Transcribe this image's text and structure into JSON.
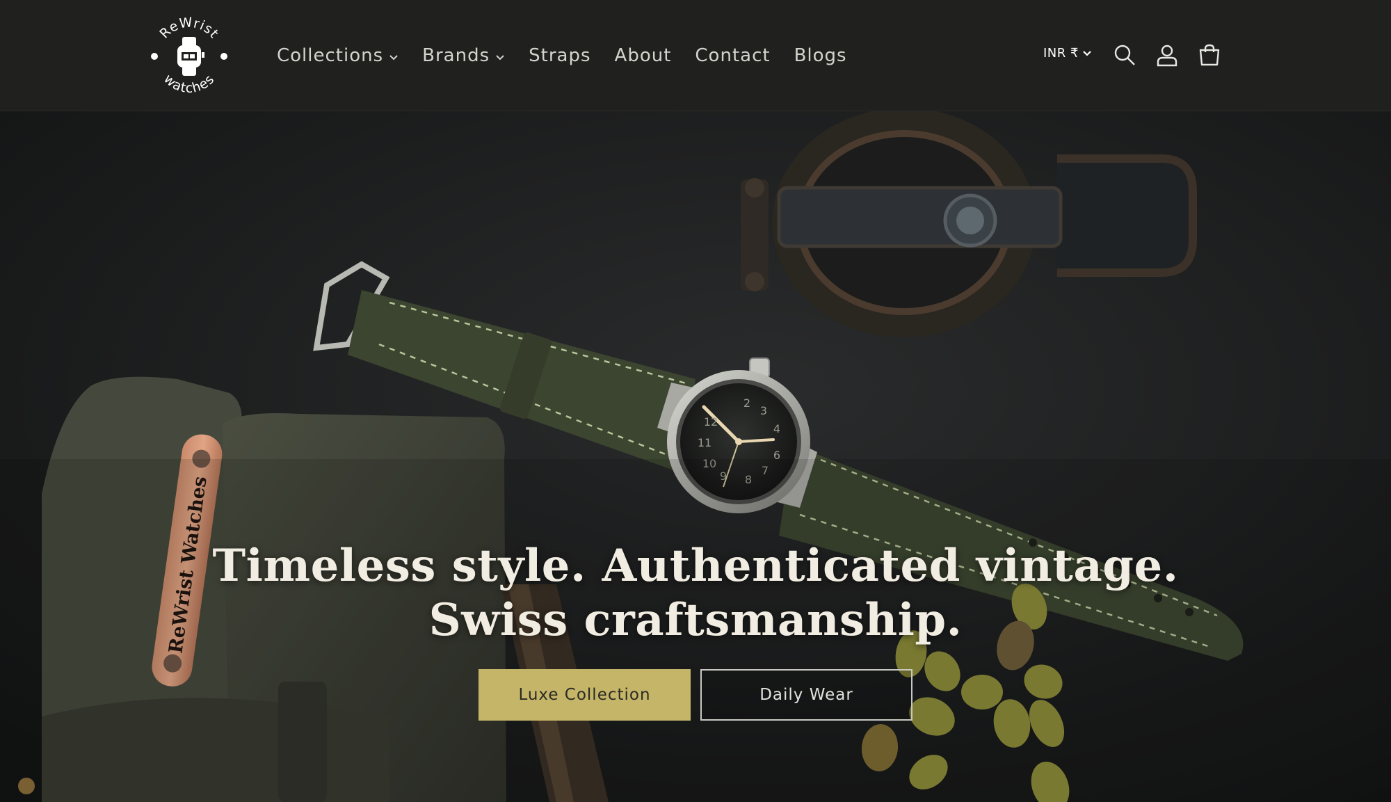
{
  "brand": {
    "logo_top_text": "ReWrist",
    "logo_bottom_text": "watches",
    "bag_tag_text": "ReWrist Watches"
  },
  "nav": {
    "items": [
      {
        "label": "Collections",
        "has_dropdown": true
      },
      {
        "label": "Brands",
        "has_dropdown": true
      },
      {
        "label": "Straps",
        "has_dropdown": false
      },
      {
        "label": "About",
        "has_dropdown": false
      },
      {
        "label": "Contact",
        "has_dropdown": false
      },
      {
        "label": "Blogs",
        "has_dropdown": false
      }
    ]
  },
  "header": {
    "currency": "INR ₹",
    "icons": [
      "search-icon",
      "account-icon",
      "cart-icon"
    ]
  },
  "hero": {
    "headline_line1": "Timeless style. Authenticated vintage.",
    "headline_line2": "Swiss craftsmanship.",
    "primary_button": "Luxe Collection",
    "secondary_button": "Daily Wear"
  },
  "colors": {
    "header_bg": "#20211f",
    "accent_button": "#c5b569",
    "hero_bg": "#1b1c1a",
    "strap_green": "#3c4530"
  }
}
